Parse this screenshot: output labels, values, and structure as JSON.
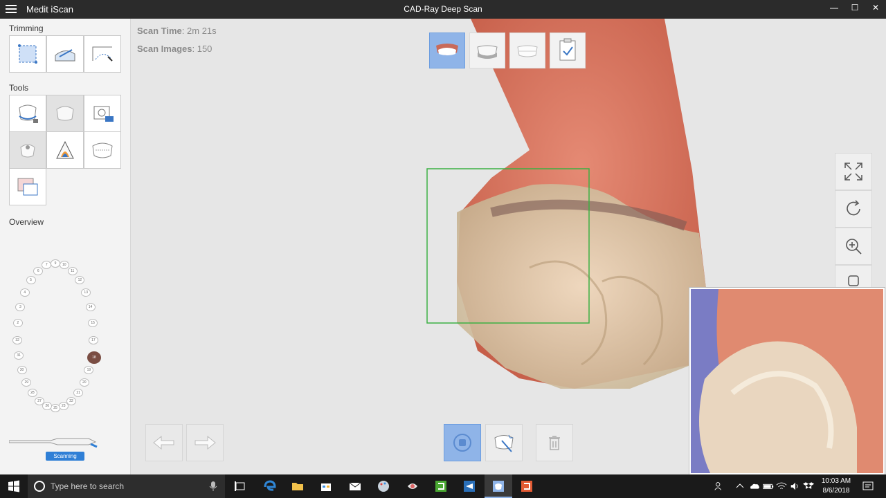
{
  "titlebar": {
    "app_name": "Medit iScan",
    "window_title": "CAD-Ray Deep Scan",
    "minimize": "—",
    "maximize": "☐",
    "close": "✕"
  },
  "sidebar": {
    "trimming_label": "Trimming",
    "tools_label": "Tools",
    "overview_label": "Overview",
    "status": "Scanning",
    "teeth_upper": [
      "1",
      "2",
      "3",
      "4",
      "5",
      "6",
      "7",
      "8",
      "9",
      "10",
      "11",
      "12",
      "13",
      "14",
      "15",
      "16"
    ],
    "teeth_lower": [
      "17",
      "18",
      "19",
      "20",
      "21",
      "22",
      "23",
      "24",
      "25",
      "26",
      "27",
      "28",
      "29",
      "30",
      "31",
      "32"
    ],
    "selected_tooth": "18"
  },
  "stats": {
    "scan_time_label": "Scan Time",
    "scan_time_value": ": 2m 21s",
    "scan_images_label": "Scan Images",
    "scan_images_value": ": 150"
  },
  "taskbar": {
    "search_placeholder": "Type here to search",
    "time": "10:03 AM",
    "date": "8/6/2018"
  },
  "colors": {
    "accent": "#8fb4e8",
    "status_blue": "#2f7fd6",
    "gingiva": "#d9735f",
    "scan_box": "#3cb043"
  }
}
